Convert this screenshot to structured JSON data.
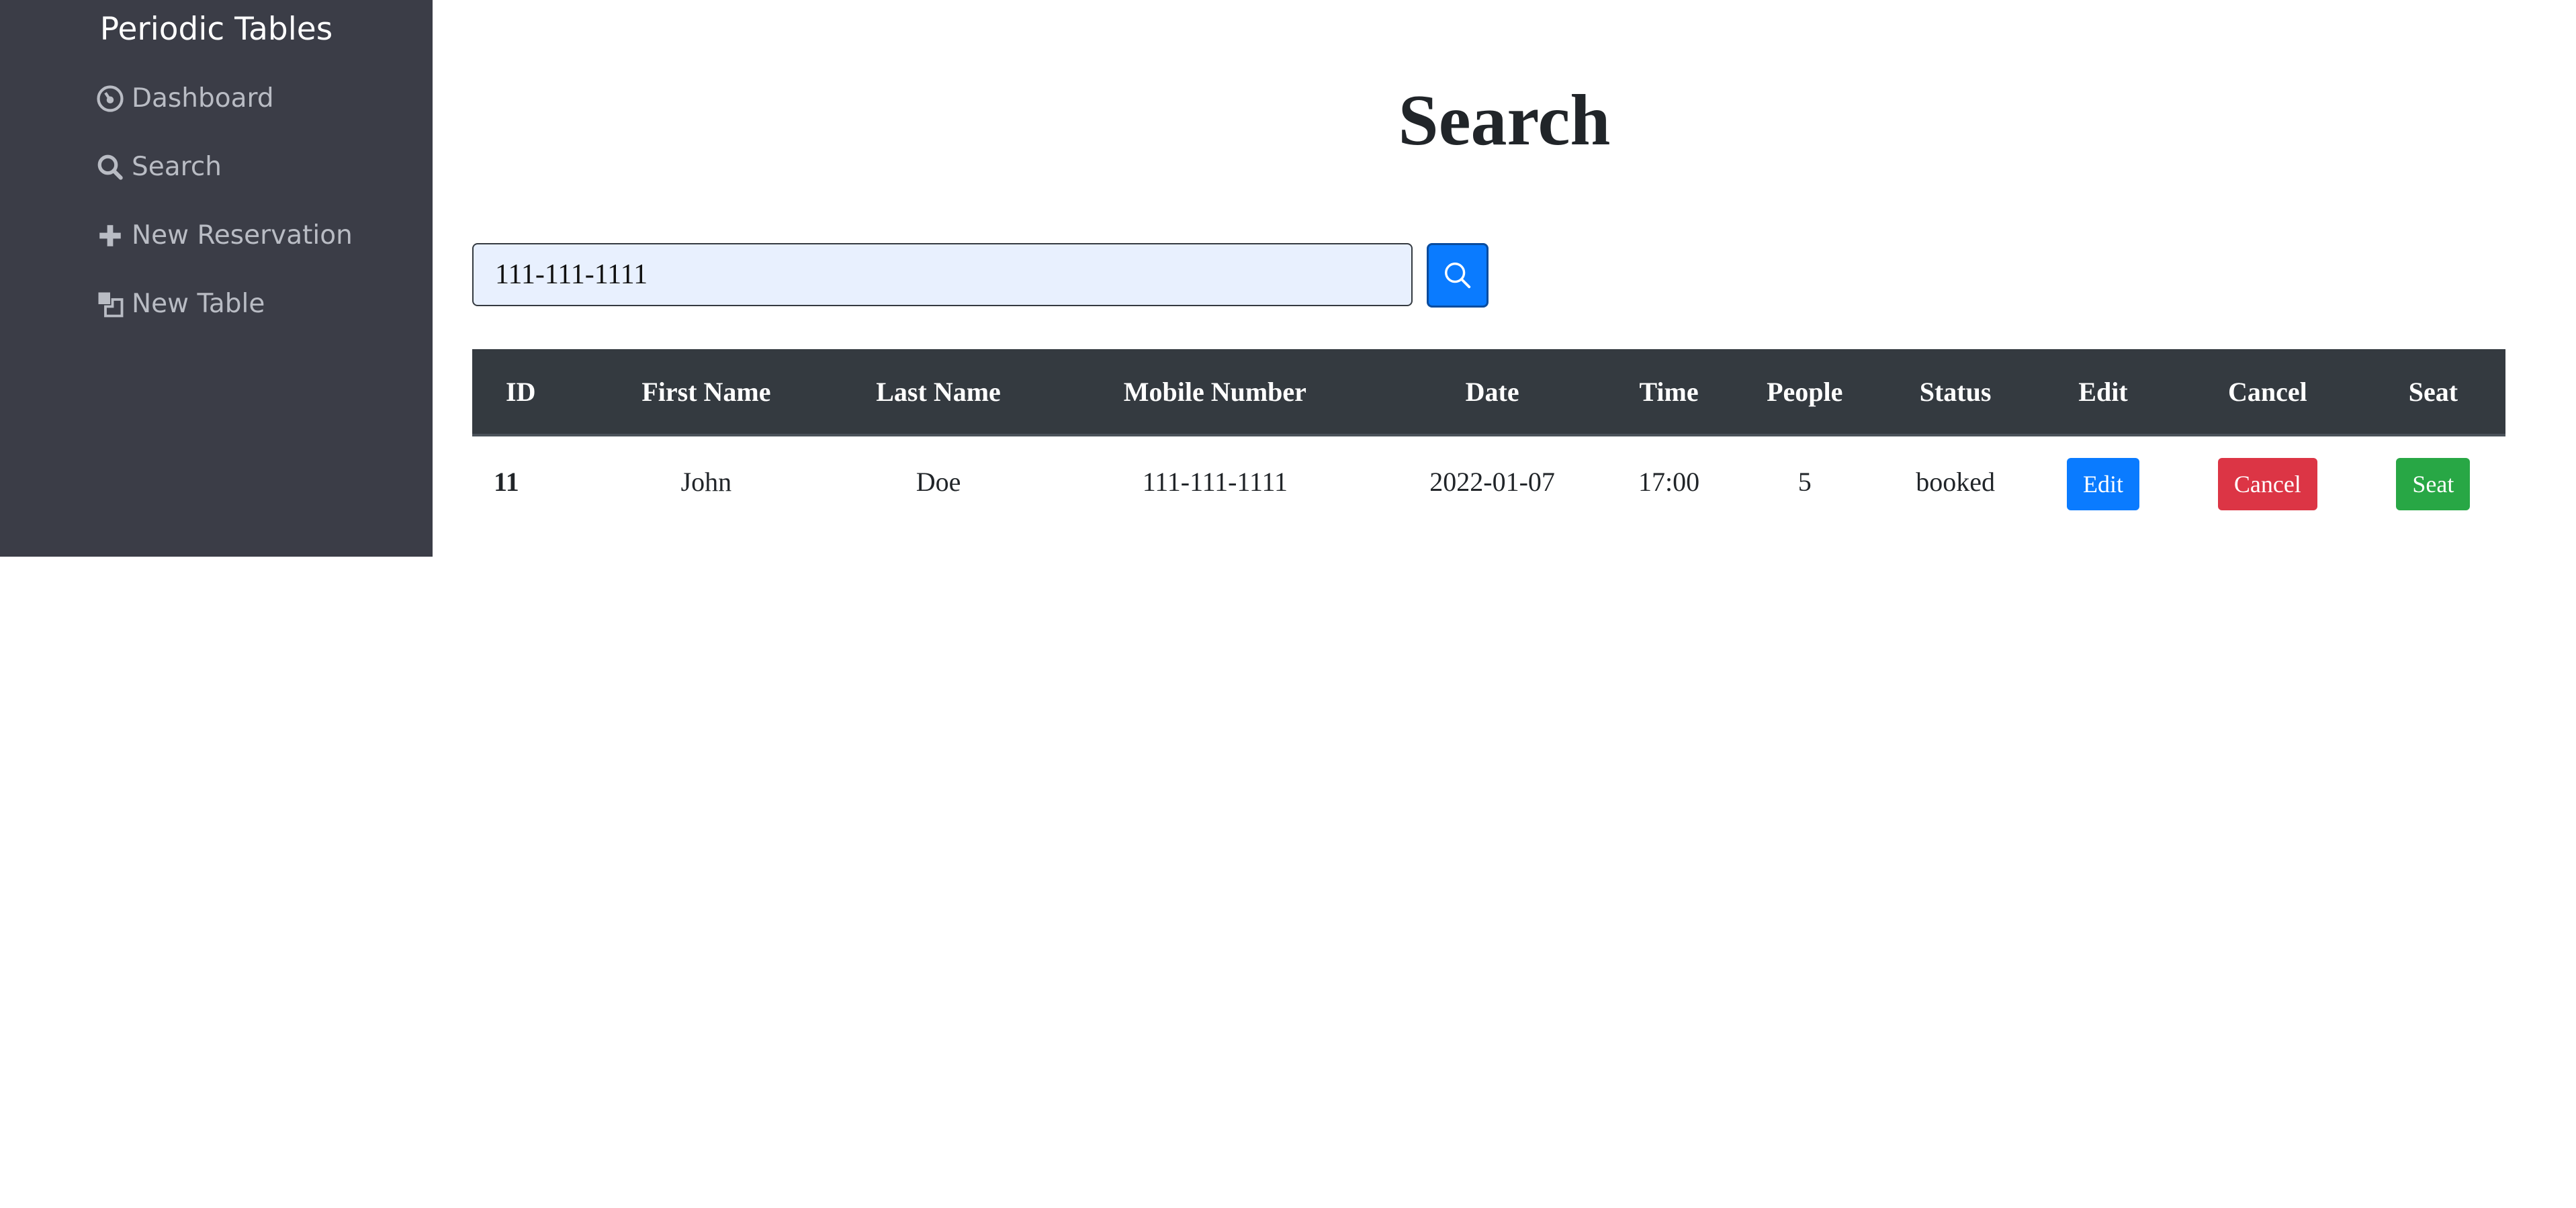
{
  "sidebar": {
    "brand": "Periodic Tables",
    "items": [
      {
        "label": "Dashboard",
        "icon": "dashboard-icon"
      },
      {
        "label": "Search",
        "icon": "search-icon"
      },
      {
        "label": "New Reservation",
        "icon": "plus-icon"
      },
      {
        "label": "New Table",
        "icon": "new-table-icon"
      }
    ]
  },
  "main": {
    "title": "Search",
    "search": {
      "value": "111-111-1111",
      "button_icon": "search-icon"
    },
    "table": {
      "headers": [
        "ID",
        "First Name",
        "Last Name",
        "Mobile Number",
        "Date",
        "Time",
        "People",
        "Status",
        "Edit",
        "Cancel",
        "Seat"
      ],
      "rows": [
        {
          "id": "11",
          "first_name": "John",
          "last_name": "Doe",
          "mobile_number": "111-111-1111",
          "date": "2022-01-07",
          "time": "17:00",
          "people": "5",
          "status": "booked",
          "edit_label": "Edit",
          "cancel_label": "Cancel",
          "seat_label": "Seat"
        }
      ]
    }
  },
  "colors": {
    "sidebar_bg": "#3b3d47",
    "table_header_bg": "#343a40",
    "primary": "#0a7bff",
    "danger": "#dc3545",
    "success": "#28a745"
  }
}
